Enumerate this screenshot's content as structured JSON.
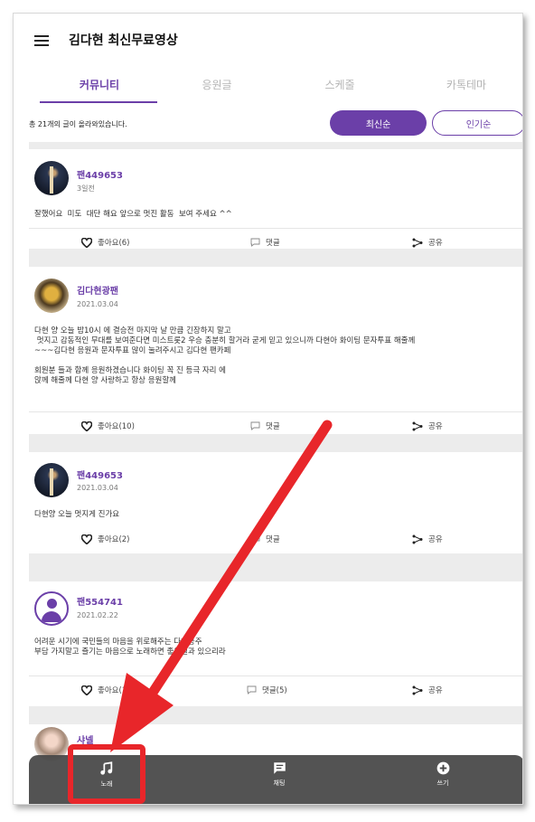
{
  "header": {
    "title": "김다현 최신무료영상"
  },
  "tabs": [
    {
      "label": "커뮤니티",
      "active": true
    },
    {
      "label": "응원글",
      "active": false
    },
    {
      "label": "스케줄",
      "active": false
    },
    {
      "label": "카톡테마",
      "active": false
    }
  ],
  "sortbar": {
    "count_text": "총 21개의 글이 올라와있습니다.",
    "latest_label": "최신순",
    "popular_label": "인기순"
  },
  "posts": [
    {
      "author": "팬449653",
      "date": "3일전",
      "avatar": "night-tower-avatar",
      "body": "잘했어요  미도  대단 해요 앞으로 멋진 활동  보여 주세요 ^^",
      "like_label": "좋아요(6)",
      "comment_label": "댓글",
      "share_label": "공유"
    },
    {
      "author": "김다현광팬",
      "date": "2021.03.04",
      "avatar": "helmet-avatar",
      "body": "다현 양 오늘 밤10시 에 결승전 마지막 날 만큼 긴장하지 말고\n 멋지고 감동적인 무대를 보여준다면 미스트롯2 우승 충분히 할거라 굳게 믿고 있으니까 다현아 화이팅 문자투표 해줄께\n~~~김다현 응원과 문자투표 많이 눌려주시고 김다현 팬카페\n\n회원분 들과 함께 응원하겠습니다 화이팅 꼭 진 등극 자리 에\n앉께 해줄께 다현 양 사랑하고 항상 응원할께",
      "like_label": "좋아요(10)",
      "comment_label": "댓글",
      "share_label": "공유"
    },
    {
      "author": "팬449653",
      "date": "2021.03.04",
      "avatar": "night-tower-avatar",
      "body": "다현양 오늘 멋지게 진가요",
      "like_label": "좋아요(2)",
      "comment_label": "댓글",
      "share_label": "공유"
    },
    {
      "author": "팬554741",
      "date": "2021.02.22",
      "avatar": "default-user-avatar",
      "body": "어려운 시기에 국민들의 마음을 위로해주는 다현공주\n부담 가지말고 즐기는 마음으로 노래하면 좋은결과 있으리라",
      "like_label": "좋아요(14)",
      "comment_label": "댓글(5)",
      "share_label": "공유"
    },
    {
      "author": "샤넬",
      "date": "",
      "avatar": "girl-photo-avatar"
    }
  ],
  "bottom_nav": [
    {
      "label": "노래",
      "icon": "music-note-icon"
    },
    {
      "label": "채팅",
      "icon": "chat-icon"
    },
    {
      "label": "쓰기",
      "icon": "plus-circle-icon"
    }
  ],
  "annotation": {
    "arrow_color": "#e8262a",
    "highlight_color": "#e8262a"
  },
  "colors": {
    "accent": "#6b3fa8",
    "feed_background": "#ececec",
    "nav_background": "#464646"
  }
}
